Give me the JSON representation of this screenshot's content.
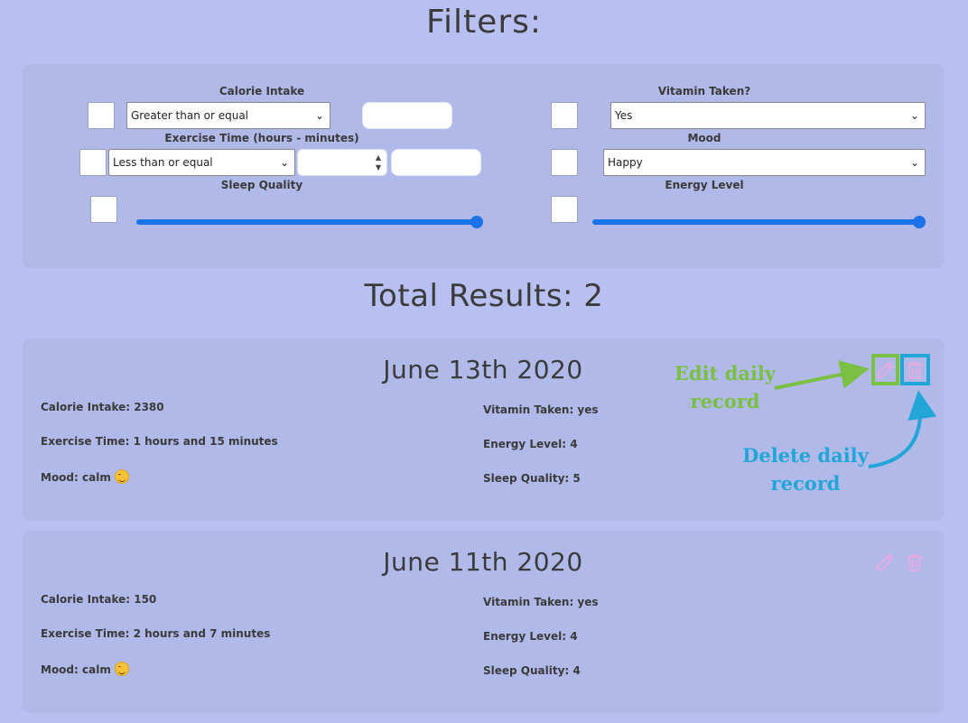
{
  "header": {
    "title": "Filters:"
  },
  "filters": {
    "calorie": {
      "label": "Calorie Intake",
      "operator": "Greater than or equal",
      "value": ""
    },
    "exercise": {
      "label": "Exercise Time (hours - minutes)",
      "operator": "Less than or equal",
      "hours": "",
      "minutes": ""
    },
    "sleep": {
      "label": "Sleep Quality",
      "level": 1.0
    },
    "vitamin": {
      "label": "Vitamin Taken?",
      "value": "Yes"
    },
    "mood": {
      "label": "Mood",
      "value": "Happy"
    },
    "energy": {
      "label": "Energy Level",
      "level": 1.0
    }
  },
  "results": {
    "title": "Total Results: 2"
  },
  "records": [
    {
      "date": "June 13th 2020",
      "calorie": "Calorie Intake: 2380",
      "exercise": "Exercise Time: 1 hours and 15 minutes",
      "mood": "Mood: calm",
      "vitamin": "Vitamin Taken: yes",
      "energy": "Energy Level: 4",
      "sleep": "Sleep Quality: 5"
    },
    {
      "date": "June 11th 2020",
      "calorie": "Calorie Intake: 150",
      "exercise": "Exercise Time: 2 hours and 7 minutes",
      "mood": "Mood: calm",
      "vitamin": "Vitamin Taken: yes",
      "energy": "Energy Level: 4",
      "sleep": "Sleep Quality: 4"
    }
  ],
  "annotations": {
    "edit_line1": "Edit daily",
    "edit_line2": "record",
    "delete_line1": "Delete daily",
    "delete_line2": "record"
  },
  "colors": {
    "background": "#b8c0f1",
    "panel": "#b0b9e8",
    "slider": "#1a73e8",
    "icon": "#f0a8e0",
    "edit_highlight": "#7ac043",
    "delete_highlight": "#22a6d8"
  },
  "icons": {
    "edit": "pencil-icon",
    "delete": "trash-icon",
    "mood": "smiley-emoji"
  }
}
